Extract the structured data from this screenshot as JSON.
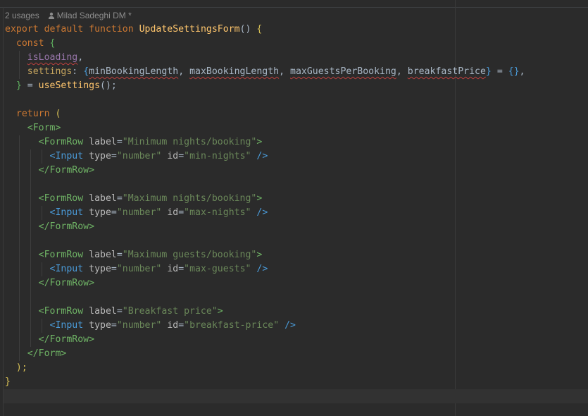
{
  "hint": {
    "usages": "2 usages",
    "author": "Milad Sadeghi DM *"
  },
  "code": {
    "l1": {
      "kw1": "export",
      "kw2": "default",
      "kw3": "function",
      "name": "UpdateSettingsForm",
      "parens": "()",
      "brace": "{"
    },
    "l2": {
      "kw": "const",
      "brace": "{"
    },
    "l3": {
      "var": "isLoading",
      "comma": ","
    },
    "l4": {
      "prop": "settings",
      "colon": ": ",
      "open": "{",
      "a": "minBookingLength",
      "b": "maxBookingLength",
      "c": "maxGuestsPerBooking",
      "d": "breakfastPrice",
      "close": "}",
      "eq": " = ",
      "empty": "{}",
      "end": ","
    },
    "l5": {
      "close": "}",
      "eq": " = ",
      "fn": "useSettings",
      "call": "();"
    },
    "l7": {
      "kw": "return",
      "paren": "("
    },
    "l8": {
      "tag": "<Form>"
    },
    "rows": [
      {
        "open": "<FormRow",
        "attr": "label",
        "eq": "=",
        "label": "\"Minimum nights/booking\"",
        "gt": ">",
        "input": "<Input",
        "typeAttr": "type",
        "typeVal": "\"number\"",
        "idAttr": "id",
        "idVal": "\"min-nights\"",
        "selfClose": "/>",
        "close": "</FormRow>"
      },
      {
        "open": "<FormRow",
        "attr": "label",
        "eq": "=",
        "label": "\"Maximum nights/booking\"",
        "gt": ">",
        "input": "<Input",
        "typeAttr": "type",
        "typeVal": "\"number\"",
        "idAttr": "id",
        "idVal": "\"max-nights\"",
        "selfClose": "/>",
        "close": "</FormRow>"
      },
      {
        "open": "<FormRow",
        "attr": "label",
        "eq": "=",
        "label": "\"Maximum guests/booking\"",
        "gt": ">",
        "input": "<Input",
        "typeAttr": "type",
        "typeVal": "\"number\"",
        "idAttr": "id",
        "idVal": "\"max-guests\"",
        "selfClose": "/>",
        "close": "</FormRow>"
      },
      {
        "open": "<FormRow",
        "attr": "label",
        "eq": "=",
        "label": "\"Breakfast price\"",
        "gt": ">",
        "input": "<Input",
        "typeAttr": "type",
        "typeVal": "\"number\"",
        "idAttr": "id",
        "idVal": "\"breakfast-price\"",
        "selfClose": "/>",
        "close": "</FormRow>"
      }
    ],
    "formClose": "</Form>",
    "returnClose": ");",
    "fnClose": "}"
  }
}
